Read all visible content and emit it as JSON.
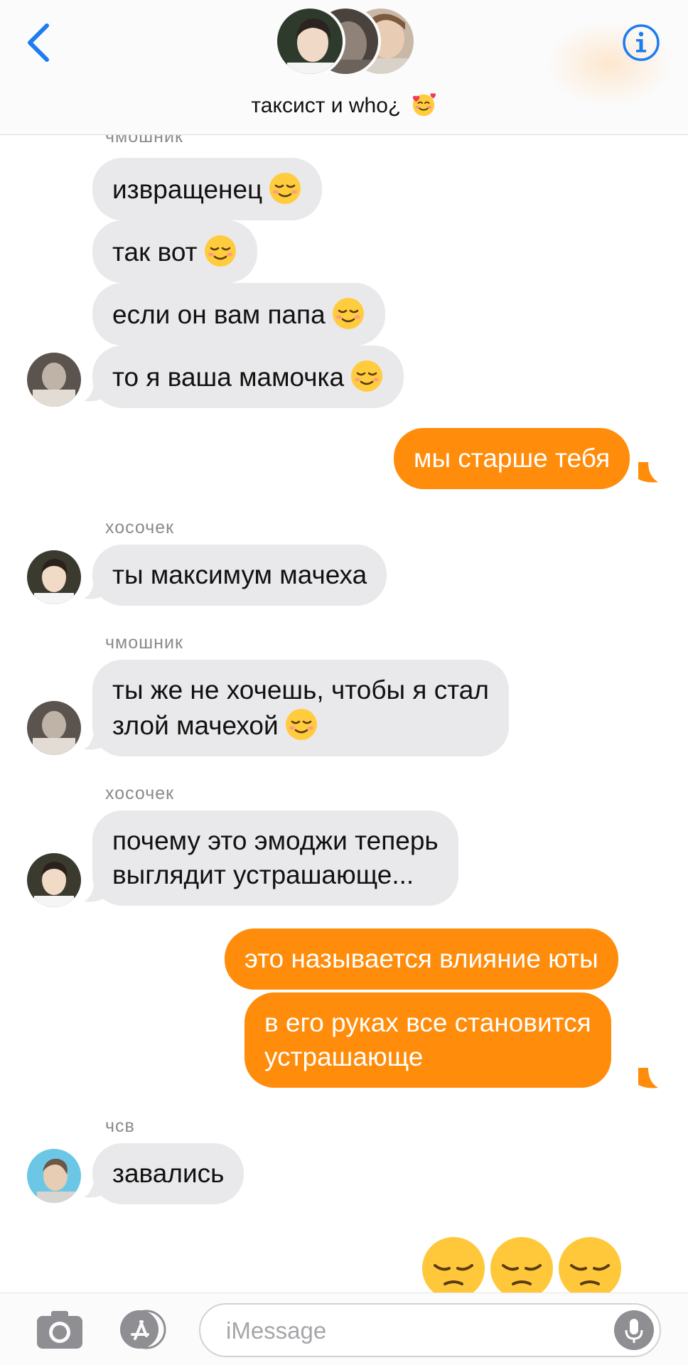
{
  "header": {
    "title": "таксист и who¿",
    "title_emoji": "smiling-face-with-hearts"
  },
  "messages": [
    {
      "sender": "чмошник",
      "direction": "incoming",
      "lines": [
        "извращенец"
      ],
      "emoji": "relieved-face"
    },
    {
      "direction": "incoming",
      "lines": [
        "так вот"
      ],
      "emoji": "relieved-face"
    },
    {
      "direction": "incoming",
      "lines": [
        "если он вам папа"
      ],
      "emoji": "relieved-face"
    },
    {
      "direction": "incoming",
      "lines": [
        "то я ваша мамочка"
      ],
      "emoji": "relieved-face"
    },
    {
      "direction": "outgoing",
      "lines": [
        "мы старше тебя"
      ]
    },
    {
      "sender": "хосочек",
      "direction": "incoming",
      "lines": [
        "ты максимум мачеха"
      ]
    },
    {
      "sender": "чмошник",
      "direction": "incoming",
      "lines": [
        "ты же не хочешь, чтобы я стал",
        "злой мачехой"
      ],
      "emoji": "relieved-face"
    },
    {
      "sender": "хосочек",
      "direction": "incoming",
      "lines": [
        "почему это эмоджи теперь",
        "выглядит устрашающе..."
      ]
    },
    {
      "direction": "outgoing",
      "lines": [
        "это называется влияние юты"
      ]
    },
    {
      "direction": "outgoing",
      "lines": [
        "в его руках все становится",
        "устрашающе"
      ]
    },
    {
      "sender": "чсв",
      "direction": "incoming",
      "lines": [
        "завались"
      ]
    },
    {
      "direction": "outgoing",
      "emoji_only": [
        "pensive-face",
        "pensive-face",
        "pensive-face"
      ]
    }
  ],
  "composer": {
    "placeholder": "iMessage"
  },
  "colors": {
    "outgoing_bubble": "#ff8c0a",
    "incoming_bubble": "#e9e9eb",
    "accent": "#1e7cf2"
  }
}
